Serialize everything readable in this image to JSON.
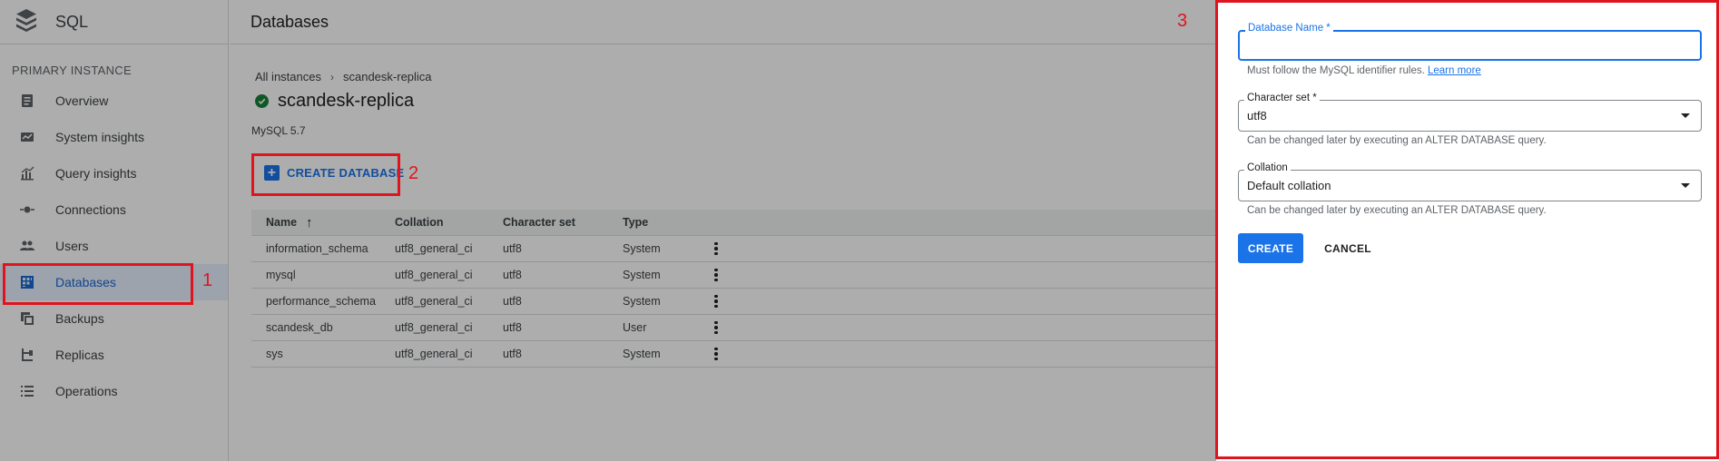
{
  "app": {
    "title": "SQL",
    "logo_icon": "sql-stack-icon"
  },
  "sidebar": {
    "section_label": "PRIMARY INSTANCE",
    "items": [
      {
        "label": "Overview",
        "icon": "list-icon"
      },
      {
        "label": "System insights",
        "icon": "dashboard-icon"
      },
      {
        "label": "Query insights",
        "icon": "chart-icon"
      },
      {
        "label": "Connections",
        "icon": "connection-icon"
      },
      {
        "label": "Users",
        "icon": "people-icon"
      },
      {
        "label": "Databases",
        "icon": "grid-icon",
        "active": true
      },
      {
        "label": "Backups",
        "icon": "backup-icon"
      },
      {
        "label": "Replicas",
        "icon": "replica-icon"
      },
      {
        "label": "Operations",
        "icon": "operations-icon"
      }
    ]
  },
  "header": {
    "title": "Databases"
  },
  "breadcrumb": {
    "root": "All instances",
    "separator": "›",
    "current": "scandesk-replica"
  },
  "instance": {
    "name": "scandesk-replica",
    "status": "running",
    "version": "MySQL 5.7"
  },
  "toolbar": {
    "create_database_label": "CREATE DATABASE"
  },
  "table": {
    "headers": {
      "name": "Name",
      "collation": "Collation",
      "charset": "Character set",
      "type": "Type"
    },
    "sort_indicator": "↑",
    "rows": [
      {
        "name": "information_schema",
        "collation": "utf8_general_ci",
        "charset": "utf8",
        "type": "System"
      },
      {
        "name": "mysql",
        "collation": "utf8_general_ci",
        "charset": "utf8",
        "type": "System"
      },
      {
        "name": "performance_schema",
        "collation": "utf8_general_ci",
        "charset": "utf8",
        "type": "System"
      },
      {
        "name": "scandesk_db",
        "collation": "utf8_general_ci",
        "charset": "utf8",
        "type": "User"
      },
      {
        "name": "sys",
        "collation": "utf8_general_ci",
        "charset": "utf8",
        "type": "System"
      }
    ]
  },
  "panel": {
    "db_name_label": "Database Name *",
    "db_name_value": "",
    "db_name_hint": "Must follow the MySQL identifier rules.",
    "learn_more": "Learn more",
    "charset_label": "Character set *",
    "charset_value": "utf8",
    "charset_hint": "Can be changed later by executing an ALTER DATABASE query.",
    "collation_label": "Collation",
    "collation_value": "Default collation",
    "collation_hint": "Can be changed later by executing an ALTER DATABASE query.",
    "create_label": "CREATE",
    "cancel_label": "CANCEL"
  },
  "annotations": [
    "1",
    "2",
    "3"
  ],
  "colors": {
    "accent": "#1a73e8",
    "annotation": "#e0141e",
    "success": "#188038"
  }
}
